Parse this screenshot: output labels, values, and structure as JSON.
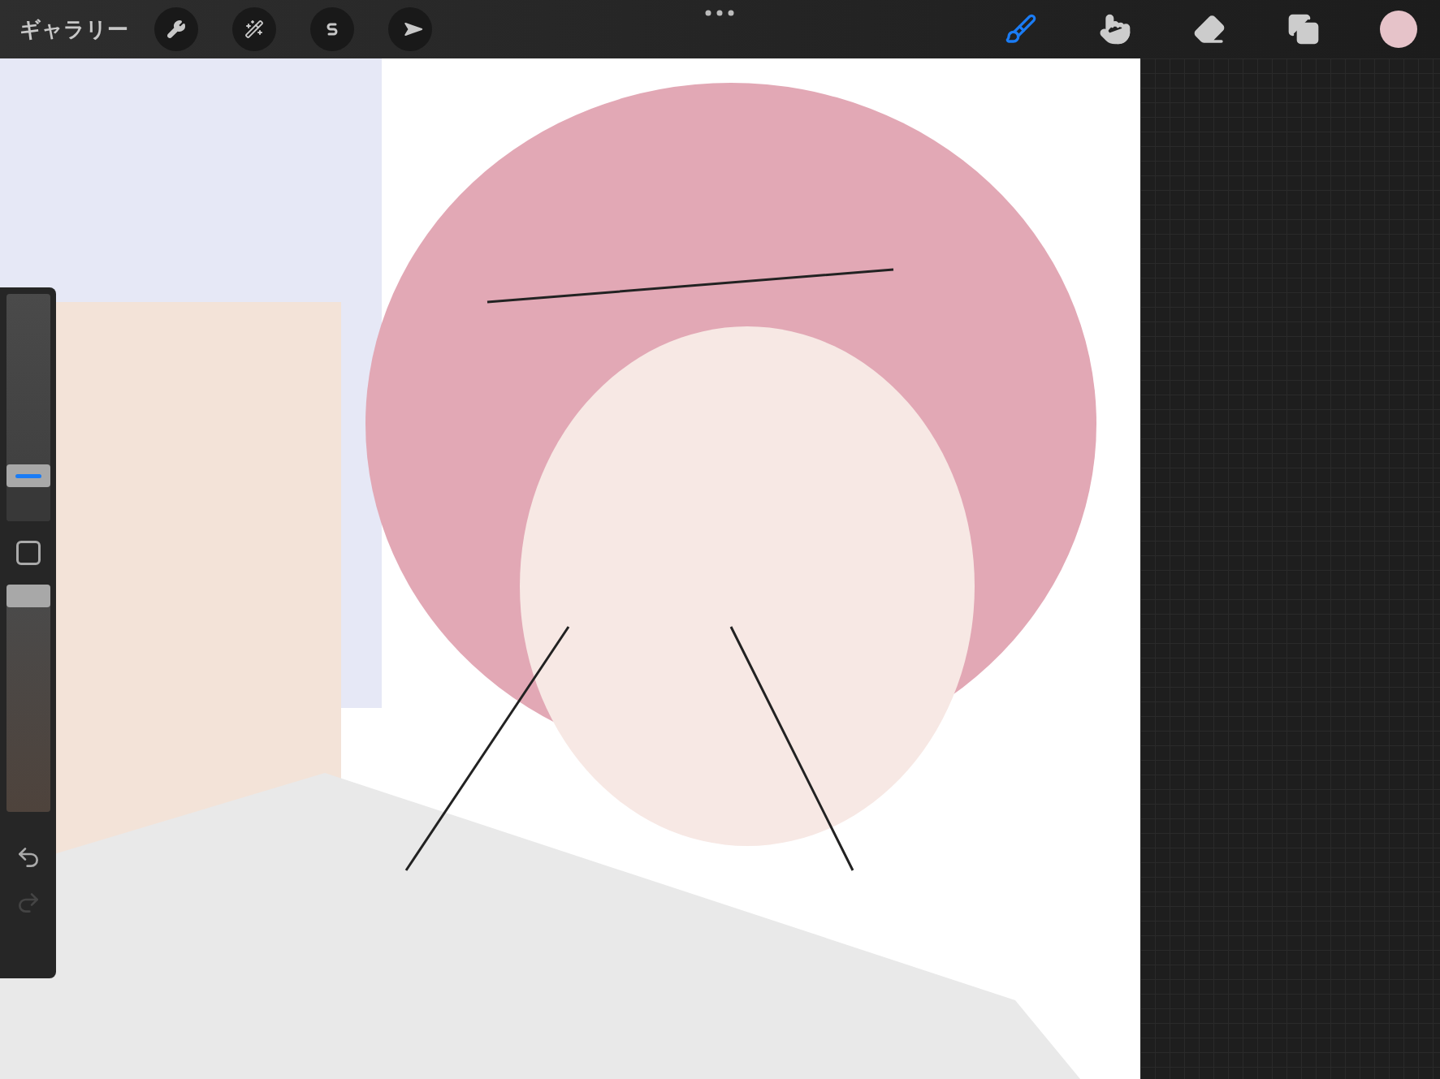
{
  "top_bar": {
    "gallery_label": "ギャラリー",
    "left_tools": [
      {
        "kind": "adjustments"
      },
      {
        "kind": "wand"
      },
      {
        "kind": "selection"
      },
      {
        "kind": "transform"
      }
    ],
    "paint_tools": [
      {
        "kind": "brush",
        "selected": true
      },
      {
        "kind": "smudge",
        "selected": false
      },
      {
        "kind": "eraser",
        "selected": false
      }
    ],
    "current_color": {
      "color": "#e6c3c9"
    }
  },
  "sidebar": {
    "brush_size": {
      "level": 0.2
    },
    "opacity": {
      "level": 1.0
    },
    "undo": {
      "disabled": false
    },
    "redo": {
      "disabled": true
    }
  }
}
